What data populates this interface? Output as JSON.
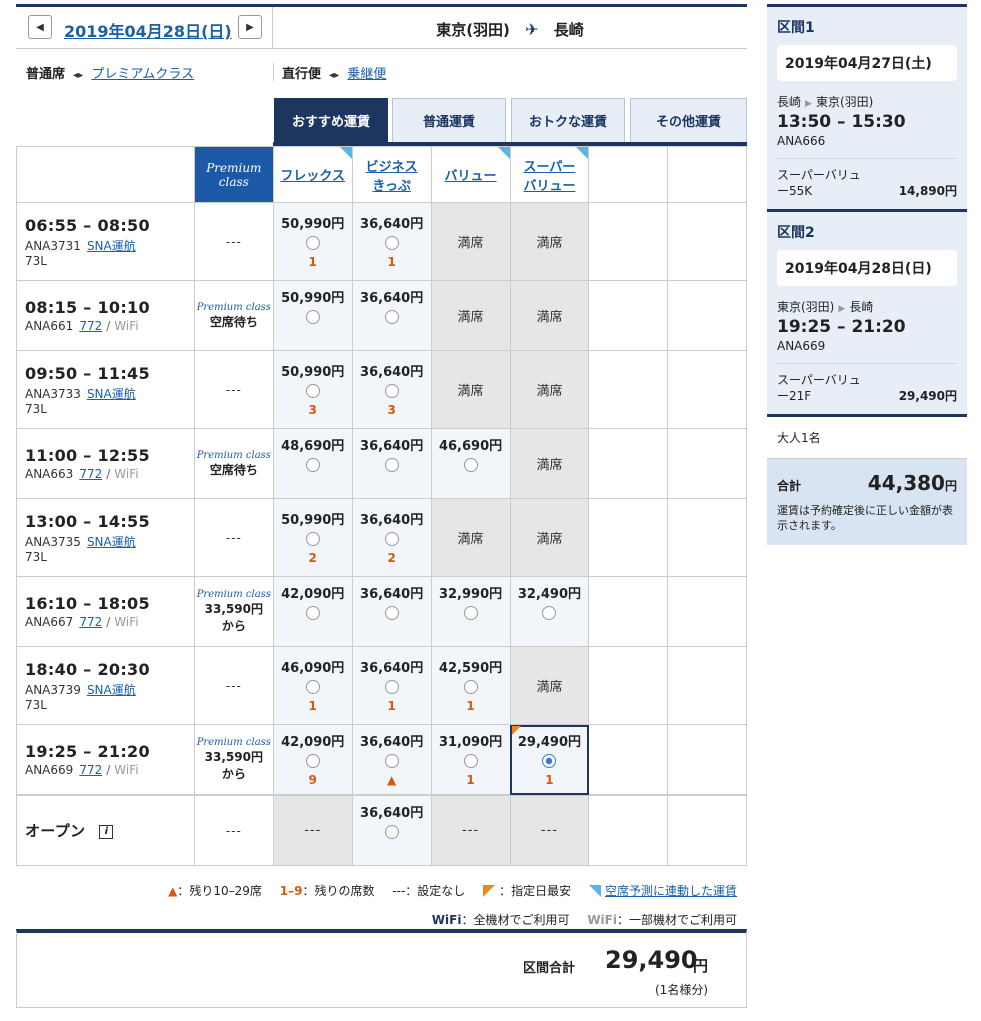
{
  "header": {
    "date": "2019年04月28日(日)",
    "prev_icon": "◀",
    "next_icon": "▶",
    "from": "東京(羽田)",
    "to": "長崎",
    "plane_icon": "✈"
  },
  "options": {
    "seat_current": "普通席",
    "seat_link": "プレミアムクラス",
    "flight_current": "直行便",
    "flight_link": "乗継便",
    "swap_icon": "◂▸"
  },
  "tabs": [
    "おすすめ運賃",
    "普通運賃",
    "おトクな運賃",
    "その他運賃"
  ],
  "columns": {
    "premium_line1": "Premium",
    "premium_line2": "class",
    "flex": "フレックス",
    "biz1": "ビジネス",
    "biz2": "きっぷ",
    "value": "バリュー",
    "super1": "スーパー",
    "super2": "バリュー"
  },
  "flights": [
    {
      "time": "06:55 – 08:50",
      "no": "ANA3731",
      "aircraft": "SNA運航",
      "sub": "73L",
      "wifi": "",
      "premium": "---",
      "premium_sub": "",
      "flex": "50,990円",
      "flex_s": "1",
      "biz": "36,640円",
      "biz_s": "1",
      "value": "満席",
      "value_s": "",
      "super": "満席",
      "super_s": ""
    },
    {
      "time": "08:15 – 10:10",
      "no": "ANA661",
      "aircraft": "772",
      "sub": "",
      "wifi": "WiFi",
      "premium": "空席待ち",
      "premium_sub": "",
      "flex": "50,990円",
      "flex_s": "",
      "biz": "36,640円",
      "biz_s": "",
      "value": "満席",
      "value_s": "",
      "super": "満席",
      "super_s": ""
    },
    {
      "time": "09:50 – 11:45",
      "no": "ANA3733",
      "aircraft": "SNA運航",
      "sub": "73L",
      "wifi": "",
      "premium": "---",
      "premium_sub": "",
      "flex": "50,990円",
      "flex_s": "3",
      "biz": "36,640円",
      "biz_s": "3",
      "value": "満席",
      "value_s": "",
      "super": "満席",
      "super_s": ""
    },
    {
      "time": "11:00 – 12:55",
      "no": "ANA663",
      "aircraft": "772",
      "sub": "",
      "wifi": "WiFi",
      "premium": "空席待ち",
      "premium_sub": "",
      "flex": "48,690円",
      "flex_s": "",
      "biz": "36,640円",
      "biz_s": "",
      "value": "46,690円",
      "value_s": "",
      "super": "満席",
      "super_s": ""
    },
    {
      "time": "13:00 – 14:55",
      "no": "ANA3735",
      "aircraft": "SNA運航",
      "sub": "73L",
      "wifi": "",
      "premium": "---",
      "premium_sub": "",
      "flex": "50,990円",
      "flex_s": "2",
      "biz": "36,640円",
      "biz_s": "2",
      "value": "満席",
      "value_s": "",
      "super": "満席",
      "super_s": ""
    },
    {
      "time": "16:10 – 18:05",
      "no": "ANA667",
      "aircraft": "772",
      "sub": "",
      "wifi": "WiFi",
      "premium": "33,590円",
      "premium_sub": "から",
      "flex": "42,090円",
      "flex_s": "",
      "biz": "36,640円",
      "biz_s": "",
      "value": "32,990円",
      "value_s": "",
      "super": "32,490円",
      "super_s": ""
    },
    {
      "time": "18:40 – 20:30",
      "no": "ANA3739",
      "aircraft": "SNA運航",
      "sub": "73L",
      "wifi": "",
      "premium": "---",
      "premium_sub": "",
      "flex": "46,090円",
      "flex_s": "1",
      "biz": "36,640円",
      "biz_s": "1",
      "value": "42,590円",
      "value_s": "1",
      "super": "満席",
      "super_s": ""
    },
    {
      "time": "19:25 – 21:20",
      "no": "ANA669",
      "aircraft": "772",
      "sub": "",
      "wifi": "WiFi",
      "premium": "33,590円",
      "premium_sub": "から",
      "flex": "42,090円",
      "flex_s": "9",
      "biz": "36,640円",
      "biz_s": "▲",
      "value": "31,090円",
      "value_s": "1",
      "super": "29,490円",
      "super_s": "1"
    }
  ],
  "premium_logo": "Premium class",
  "open_row": {
    "label": "オープン",
    "info_icon": "i",
    "premium": "---",
    "flex": "---",
    "biz": "36,640円",
    "value": "---",
    "super": "---"
  },
  "legend": {
    "tri": "▲",
    "tri_text": "：残り10–29席",
    "range": "1–9",
    "range_text": "：残りの席数",
    "dash": "---",
    "dash_text": "：設定なし",
    "cheap_text": "：指定日最安",
    "linked_text": "空席予測に連動した運賃",
    "wifi": "WiFi",
    "wifi_all": "：全機材でご利用可",
    "wifi_some": "：一部機材でご利用可"
  },
  "total": {
    "label": "区間合計",
    "amount": "29,490",
    "yen": "円",
    "per": "(1名様分)"
  },
  "side": {
    "seg1": {
      "title": "区間1",
      "date": "2019年04月27日(土)",
      "from": "長崎",
      "to": "東京(羽田)",
      "time": "13:50 – 15:30",
      "flight": "ANA666",
      "fare_name": "スーパーバリュー55K",
      "fare_price": "14,890円"
    },
    "seg2": {
      "title": "区間2",
      "date": "2019年04月28日(日)",
      "from": "東京(羽田)",
      "to": "長崎",
      "time": "19:25 – 21:20",
      "flight": "ANA669",
      "fare_name": "スーパーバリュー21F",
      "fare_price": "29,490円"
    },
    "pax": "大人1名",
    "total_label": "合計",
    "total_amount": "44,380",
    "total_yen": "円",
    "note": "運賃は予約確定後に正しい金額が表示されます。"
  }
}
